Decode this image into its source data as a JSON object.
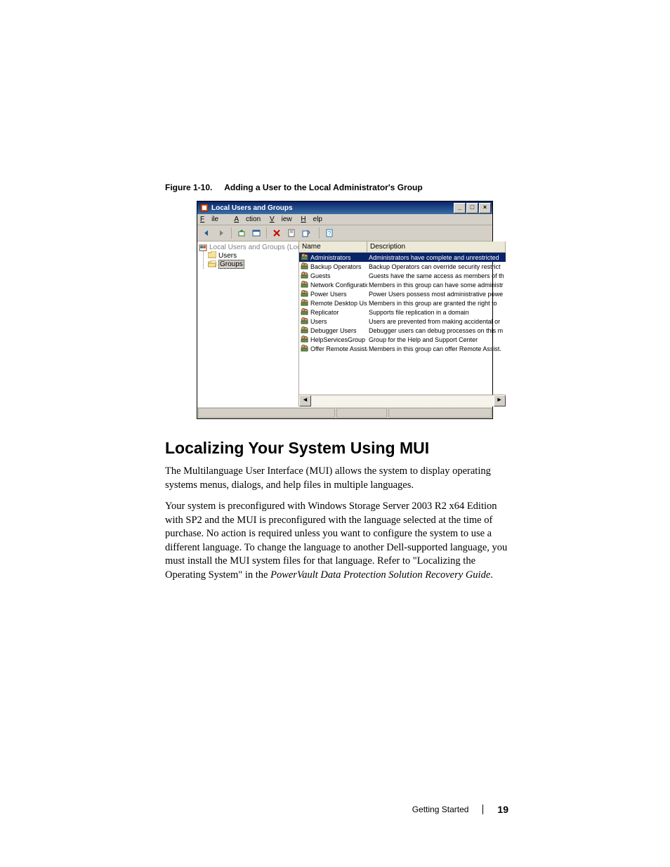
{
  "figure": {
    "label": "Figure 1-10.",
    "title": "Adding a User to the Local Administrator's Group"
  },
  "mmc": {
    "title": "Local Users and Groups",
    "menus": {
      "file": "File",
      "action": "Action",
      "view": "View",
      "help": "Help"
    },
    "tree": {
      "root": "Local Users and Groups (Local)",
      "users": "Users",
      "groups": "Groups"
    },
    "columns": {
      "name": "Name",
      "desc": "Description"
    },
    "rows": [
      {
        "name": "Administrators",
        "desc": "Administrators have complete and unrestricted",
        "selected": true
      },
      {
        "name": "Backup Operators",
        "desc": "Backup Operators can override security restrict"
      },
      {
        "name": "Guests",
        "desc": "Guests have the same access as members of th"
      },
      {
        "name": "Network Configuration ...",
        "desc": "Members in this group can have some administr"
      },
      {
        "name": "Power Users",
        "desc": "Power Users possess most administrative powe"
      },
      {
        "name": "Remote Desktop Users",
        "desc": "Members in this group are granted the right to"
      },
      {
        "name": "Replicator",
        "desc": "Supports file replication in a domain"
      },
      {
        "name": "Users",
        "desc": "Users are prevented from making accidental or"
      },
      {
        "name": "Debugger Users",
        "desc": "Debugger users can debug processes on this m"
      },
      {
        "name": "HelpServicesGroup",
        "desc": "Group for the Help and Support Center"
      },
      {
        "name": "Offer Remote Assistanc...",
        "desc": "Members in this group can offer Remote Assist."
      }
    ]
  },
  "heading": "Localizing Your System Using MUI",
  "para1": "The Multilanguage User Interface (MUI) allows the system to display operating systems menus, dialogs, and help files in multiple languages.",
  "para2a": "Your system is preconfigured with Windows Storage Server 2003 R2 x64 Edition with SP2 and the MUI is preconfigured with the language selected at the time of purchase. No action is required unless you want to configure the system to use a different language. To change the language to another Dell-supported language, you must install the MUI system files for that language. Refer to \"Localizing the Operating System\" in the ",
  "para2b": "PowerVault Data Protection Solution Recovery Guide",
  "para2c": ".",
  "footer": {
    "section": "Getting Started",
    "page": "19"
  }
}
